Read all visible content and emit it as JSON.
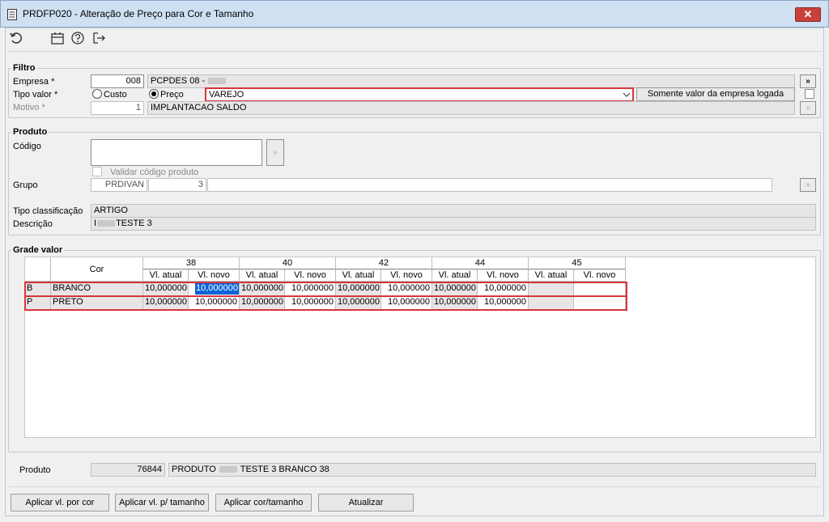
{
  "window": {
    "title": "PRDFP020 - Alteração de Preço para Cor e Tamanho",
    "close_glyph": "✕"
  },
  "toolbar": {
    "icons": [
      "refresh-icon",
      "calendar-icon",
      "help-icon",
      "exit-icon"
    ]
  },
  "filtro": {
    "label": "Filtro",
    "empresa_label": "Empresa *",
    "empresa_code": "008",
    "empresa_name": "PCPDES 08 -",
    "empresa_btn": "»",
    "tipo_label": "Tipo valor *",
    "custo_label": "Custo",
    "preco_label": "Preço",
    "tabela_value": "VAREJO",
    "somente_btn": "Somente valor da empresa logada",
    "motivo_label": "Motivo *",
    "motivo_code": "1",
    "motivo_name": "IMPLANTACAO SALDO"
  },
  "produto": {
    "label": "Produto",
    "codigo_label": "Código",
    "validar_label": "Validar código produto",
    "grupo_label": "Grupo",
    "grupo_code": "PRDIVAN",
    "grupo_num": "3",
    "tipo_class_label": "Tipo classificação",
    "tipo_class_value": "ARTIGO",
    "descricao_label": "Descrição",
    "descricao_prefix": "I",
    "descricao_suffix": "TESTE 3"
  },
  "grade": {
    "label": "Grade valor",
    "cor_header": "Cor",
    "sub_atual": "Vl. atual",
    "sub_novo": "Vl. novo",
    "sizes": [
      "38",
      "40",
      "42",
      "44",
      "45"
    ],
    "rows": [
      {
        "code": "B",
        "name": "BRANCO",
        "values": [
          "10,000000",
          "10,000000",
          "10,000000",
          "10,000000",
          "10,000000",
          "10,000000",
          "10,000000",
          "10,000000",
          "",
          ""
        ]
      },
      {
        "code": "P",
        "name": "PRETO",
        "values": [
          "10,000000",
          "10,000000",
          "10,000000",
          "10,000000",
          "10,000000",
          "10,000000",
          "10,000000",
          "10,000000",
          "",
          ""
        ]
      }
    ]
  },
  "status": {
    "produto_label": "Produto",
    "produto_code": "76844",
    "produto_prefix": "PRODUTO",
    "produto_suffix": "TESTE 3 BRANCO 38"
  },
  "buttons": {
    "aplicar_cor": "Aplicar vl. por cor",
    "aplicar_tamanho": "Aplicar vl. p/ tamanho",
    "aplicar_cor_tamanho": "Aplicar cor/tamanho",
    "atualizar": "Atualizar"
  },
  "colors": {
    "highlight_red": "#d9353b",
    "selection_blue": "#0a64d8",
    "close_red": "#c7403a"
  }
}
